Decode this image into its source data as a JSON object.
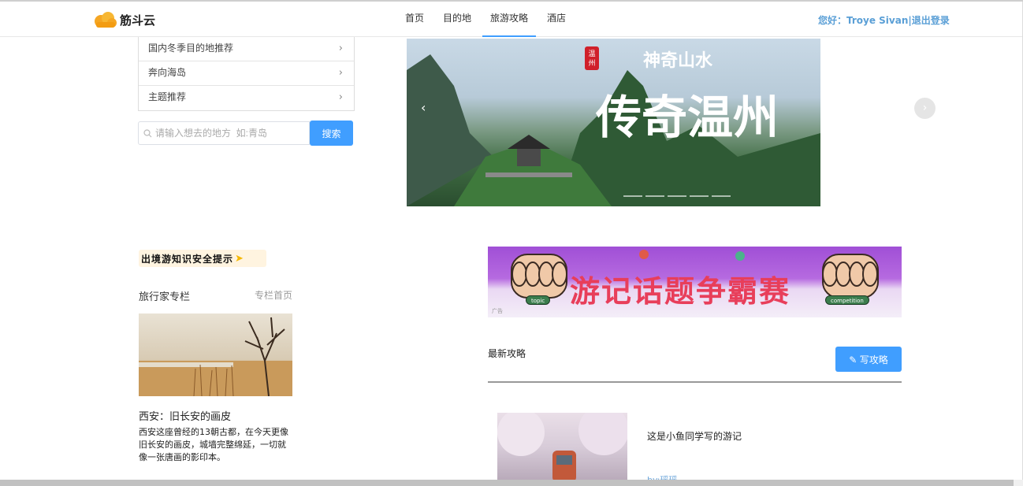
{
  "header": {
    "logo_text": "筋斗云",
    "nav": [
      "首页",
      "目的地",
      "旅游攻略",
      "酒店"
    ],
    "active_nav": "旅游攻略",
    "user_greeting": "您好：Troye Sivan|退出登录"
  },
  "sidebar": {
    "menu": [
      {
        "label": "国内冬季目的地推荐"
      },
      {
        "label": "奔向海岛"
      },
      {
        "label": "主题推荐"
      }
    ],
    "search_placeholder": "请输入想去的地方  如:青岛",
    "search_button": "搜索"
  },
  "carousel": {
    "caption_big": "传奇温州",
    "caption_small": "神奇山水",
    "seal": "温州"
  },
  "tips_banner": "出境游知识安全提示",
  "column": {
    "title": "旅行家专栏",
    "link": "专栏首页",
    "article_title": "西安：旧长安的画皮",
    "article_desc": "西安这座曾经的13朝古都，在今天更像旧长安的画皮，城墙完整绵延，一切就像一张唐画的影印本。"
  },
  "contest": {
    "title": "游记话题争霸赛",
    "pill_left": "topic",
    "pill_right": "competition",
    "ad_label": "广告"
  },
  "latest": {
    "heading": "最新攻略",
    "write_button": "写攻略",
    "posts": [
      {
        "title": "这是小鱼同学写的游记",
        "author": "by:瑶瑶"
      }
    ]
  },
  "colors": {
    "accent": "#409eff",
    "user": "#5a9fd6",
    "contest_red": "#e83e5a"
  }
}
